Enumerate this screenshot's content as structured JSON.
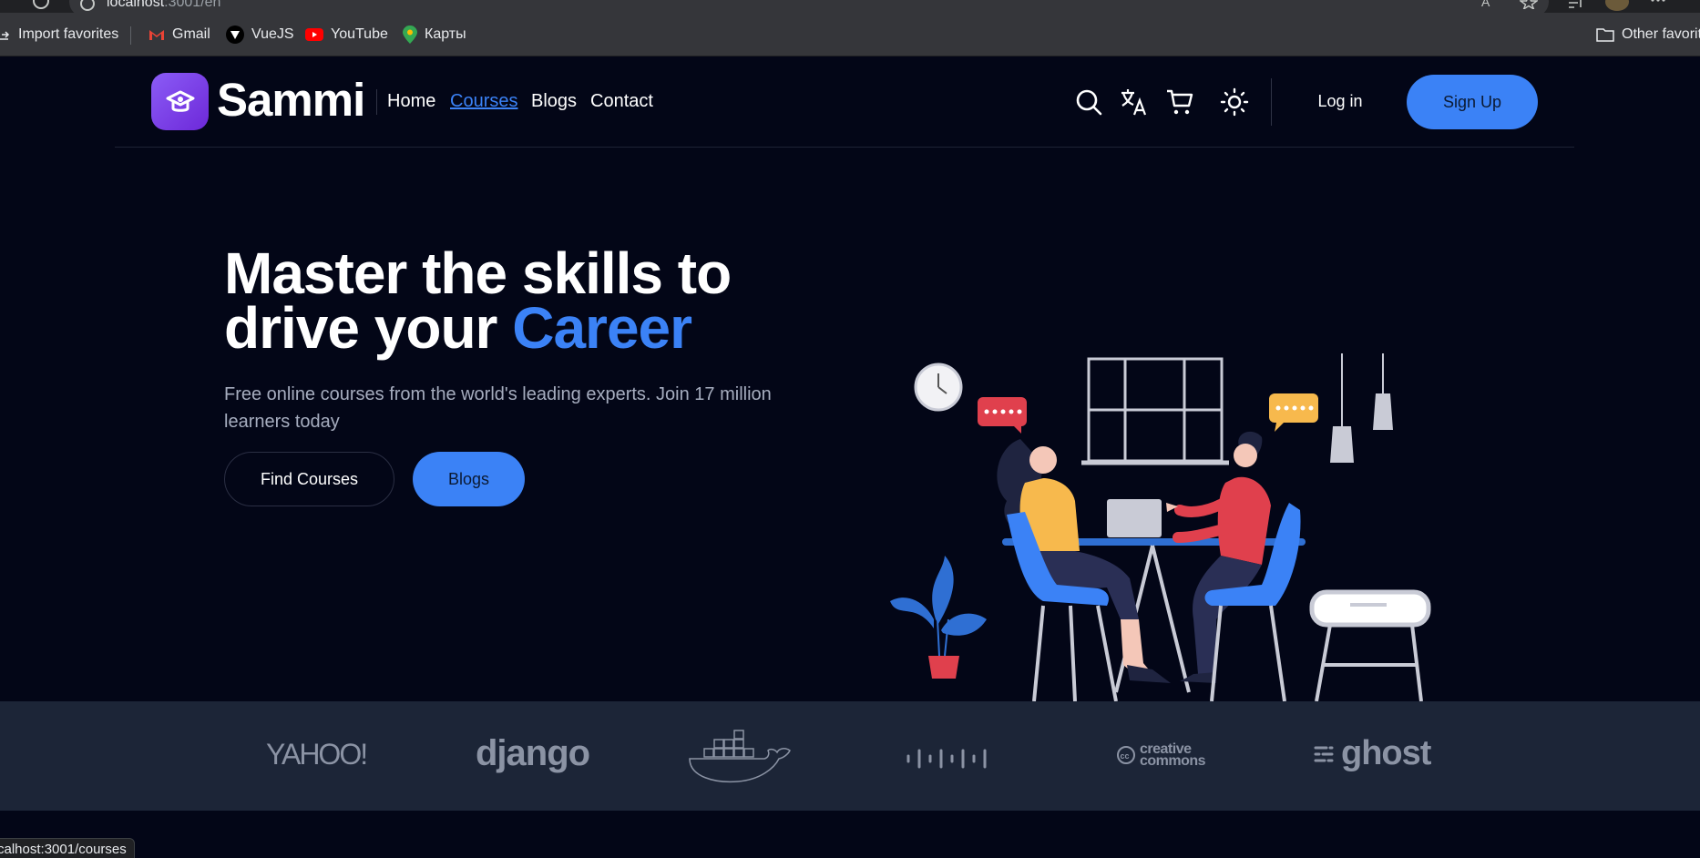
{
  "browser": {
    "url_host": "localhost",
    "url_rest": ":3001/en",
    "bookmarks": [
      {
        "label": "Import favorites",
        "icon": "import-icon"
      },
      {
        "label": "Gmail",
        "icon": "gmail-icon"
      },
      {
        "label": "VueJS",
        "icon": "vuejs-icon"
      },
      {
        "label": "YouTube",
        "icon": "youtube-icon"
      },
      {
        "label": "Карты",
        "icon": "maps-icon"
      }
    ],
    "other_favorites": "Other favorite",
    "status_url": "calhost:3001/courses"
  },
  "header": {
    "brand": "Sammi",
    "nav": [
      {
        "label": "Home",
        "active": false
      },
      {
        "label": "Courses",
        "active": true
      },
      {
        "label": "Blogs",
        "active": false
      },
      {
        "label": "Contact",
        "active": false
      }
    ],
    "icons": [
      "search-icon",
      "translate-icon",
      "cart-icon",
      "theme-toggle-icon"
    ],
    "login_label": "Log in",
    "signup_label": "Sign Up"
  },
  "hero": {
    "title_line1": "Master the skills to",
    "title_line2_prefix": "drive your ",
    "title_accent": "Career",
    "subtitle": "Free online courses from the world's leading experts. Join 17 million learners today",
    "primary_button": "Find Courses",
    "secondary_button": "Blogs"
  },
  "partners": {
    "yahoo": "YAHOO!",
    "django": "django",
    "docker": "docker-logo",
    "cisco": "cisco-logo",
    "cc_line1": "creative",
    "cc_line2": "commons",
    "ghost": "ghost"
  },
  "colors": {
    "background": "#030617",
    "accent": "#3b82f6",
    "brand_purple": "#7c3aed",
    "partners_band": "#1c2537"
  }
}
